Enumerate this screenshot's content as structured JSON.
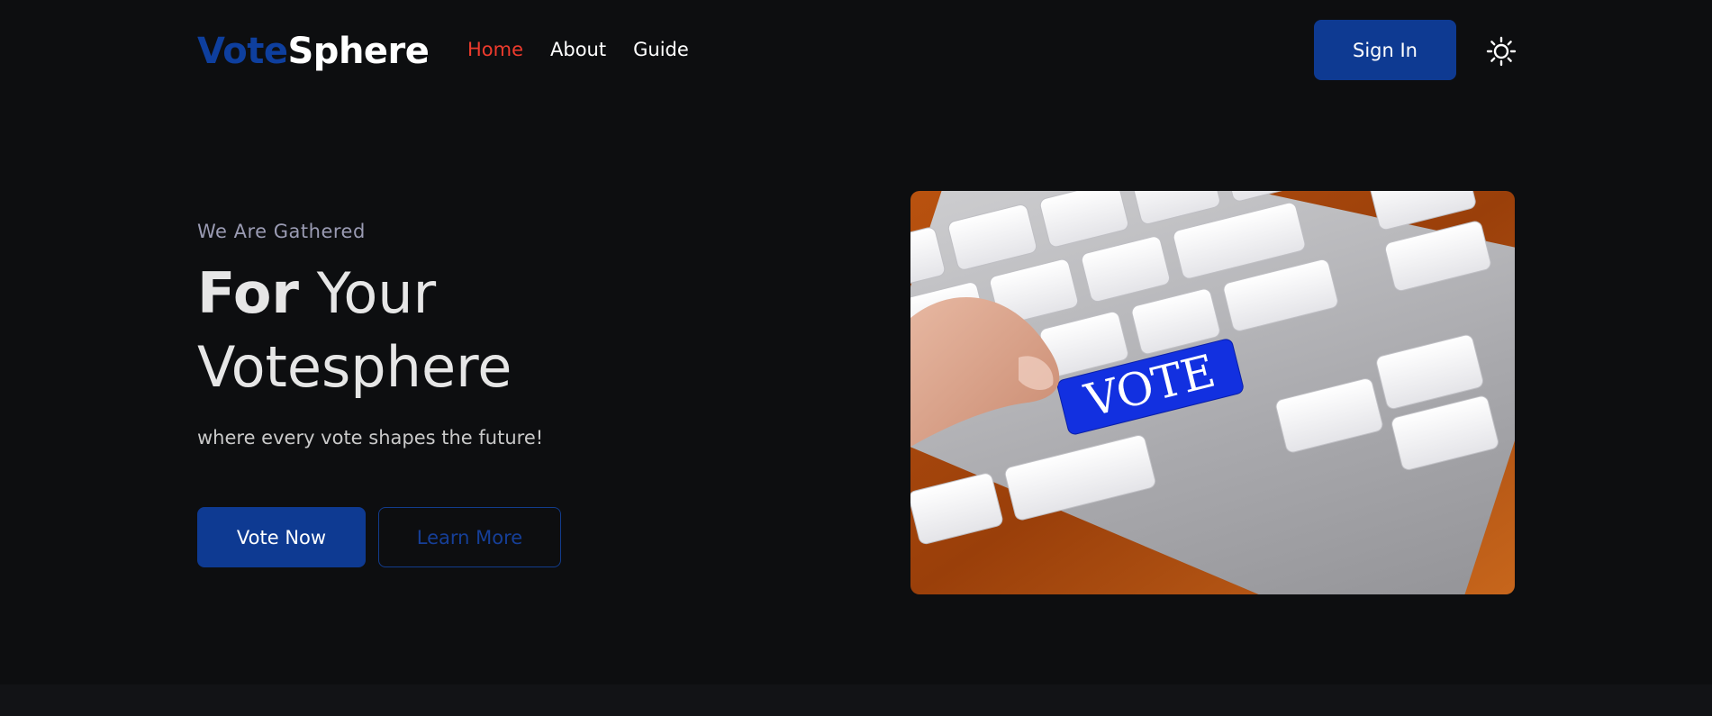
{
  "brand": {
    "name_part1": "Vote",
    "name_part2": "Sphere",
    "color_part1": "#0e3f9e",
    "color_part2": "#ffffff"
  },
  "nav": {
    "items": [
      {
        "label": "Home",
        "active": true
      },
      {
        "label": "About",
        "active": false
      },
      {
        "label": "Guide",
        "active": false
      }
    ],
    "active_color": "#ee3b2d"
  },
  "header": {
    "signin_label": "Sign In",
    "theme_icon": "sun-icon"
  },
  "hero": {
    "eyebrow": "We Are Gathered",
    "headline_strong": "For",
    "headline_rest": "Your",
    "headline_line2": "Votesphere",
    "subtitle": "where every vote shapes the future!",
    "primary_button": "Vote Now",
    "secondary_button": "Learn More",
    "image_key_label": "VOTE"
  },
  "colors": {
    "background": "#0d0e10",
    "accent": "#0e3a92"
  }
}
